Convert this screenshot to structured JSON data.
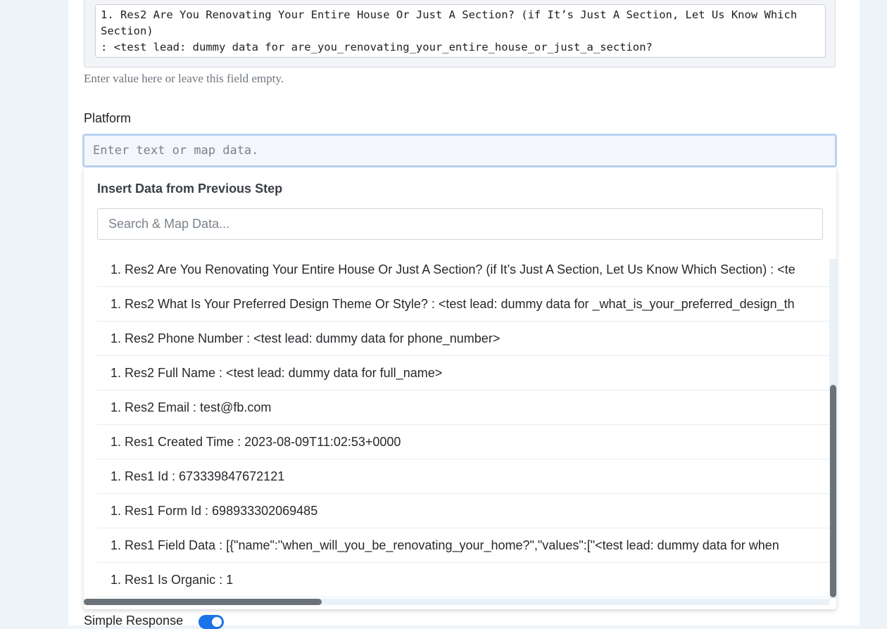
{
  "previous_field": {
    "value": "1. Res2 Are You Renovating Your Entire House Or Just A Section? (if It’s Just A Section, Let Us Know Which Section)\n: <test lead: dummy data for are_you_renovating_your_entire_house_or_just_a_section?\n_(if_it’s_just_a_section,_let_us_know_which_section)>",
    "hint": "Enter value here or leave this field empty."
  },
  "platform": {
    "label": "Platform",
    "placeholder": "Enter text or map data."
  },
  "dropdown": {
    "title": "Insert Data from Previous Step",
    "search_placeholder": "Search & Map Data...",
    "items": [
      "1. Res2 Are You Renovating Your Entire House Or Just A Section? (if It’s Just A Section, Let Us Know Which Section) : <te",
      "1. Res2 What Is Your Preferred Design Theme Or Style? : <test lead: dummy data for _what_is_your_preferred_design_th",
      "1. Res2 Phone Number : <test lead: dummy data for phone_number>",
      "1. Res2 Full Name : <test lead: dummy data for full_name>",
      "1. Res2 Email : test@fb.com",
      "1. Res1 Created Time : 2023-08-09T11:02:53+0000",
      "1. Res1 Id : 673339847672121",
      "1. Res1 Form Id : 698933302069485",
      "1. Res1 Field Data : [{\"name\":\"when_will_you_be_renovating_your_home?\",\"values\":[\"<test lead: dummy data for when",
      "1. Res1 Is Organic : 1"
    ]
  },
  "simple_response": {
    "label": "Simple Response",
    "enabled": true
  },
  "colors": {
    "toggle_on": "#1a73e8",
    "focus_border": "#b9d3f2"
  }
}
